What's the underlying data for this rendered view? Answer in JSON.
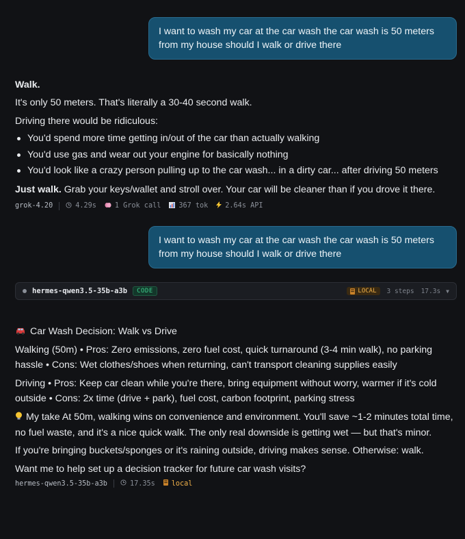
{
  "conversation": {
    "user_message_1": "I want to wash my car at the car wash the car wash is 50 meters from my house should I walk or drive there",
    "reply_1": {
      "heading": "Walk.",
      "line_1": "It's only 50 meters. That's literally a 30-40 second walk.",
      "line_2": "Driving there would be ridiculous:",
      "bullets": [
        "You'd spend more time getting in/out of the car than actually walking",
        "You'd use gas and wear out your engine for basically nothing",
        "You'd look like a crazy person pulling up to the car wash... in a dirty car... after driving 50 meters"
      ],
      "closing_bold": "Just walk.",
      "closing_rest": " Grab your keys/wallet and stroll over. Your car will be cleaner than if you drove it there."
    },
    "meta_1": {
      "model": "grok-4.20",
      "time": "4.29s",
      "calls": "1 Grok call",
      "tokens": "367 tok",
      "api": "2.64s API"
    },
    "user_message_2": "I want to wash my car at the car wash the car wash is 50 meters from my house should I walk or drive there",
    "agent_bar": {
      "model": "hermes-qwen3.5-35b-a3b",
      "code_badge": "CODE",
      "local_badge": "LOCAL",
      "steps": "3 steps",
      "time": "17.3s",
      "chevron": "▼"
    },
    "reply_2": {
      "title": "Car Wash Decision: Walk vs Drive",
      "walking": "Walking (50m) • Pros: Zero emissions, zero fuel cost, quick turnaround (3-4 min walk), no parking hassle • Cons: Wet clothes/shoes when returning, can't transport cleaning supplies easily",
      "driving": "Driving • Pros: Keep car clean while you're there, bring equipment without worry, warmer if it's cold outside • Cons: 2x time (drive + park), fuel cost, carbon footprint, parking stress",
      "take": "My take At 50m, walking wins on convenience and environment. You'll save ~1-2 minutes total time, no fuel waste, and it's a nice quick walk. The only real downside is getting wet — but that's minor.",
      "conditional": "If you're bringing buckets/sponges or it's raining outside, driving makes sense. Otherwise: walk.",
      "question": "Want me to help set up a decision tracker for future car wash visits?"
    },
    "meta_2": {
      "model": "hermes-qwen3.5-35b-a3b",
      "time": "17.35s",
      "local": "local"
    }
  },
  "icons": {
    "clock": "clock-icon",
    "brain": "brain-icon",
    "chart": "bar-chart-icon",
    "bolt": "lightning-icon",
    "local": "local-server-icon",
    "car": "car-icon",
    "bulb": "lightbulb-icon"
  },
  "colors": {
    "background": "#111215",
    "user_bubble": "#16506f",
    "code_badge": "#3fcf8e",
    "local_badge": "#f2b24a"
  }
}
